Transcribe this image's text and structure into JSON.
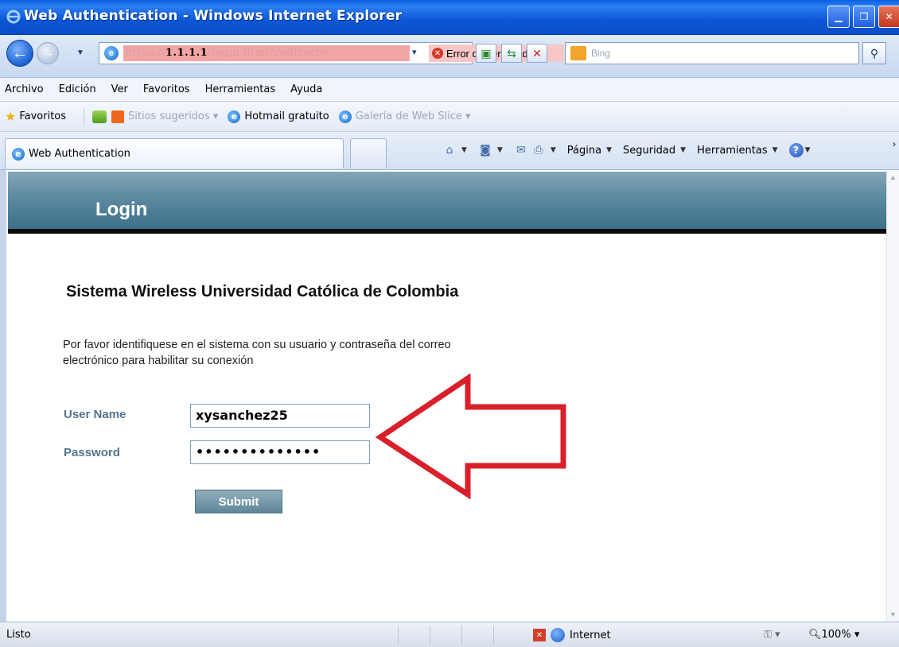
{
  "window": {
    "title": "Web Authentication - Windows Internet Explorer"
  },
  "addressbar": {
    "url_prefix": "https://",
    "url_host": "1.1.1.1",
    "url_path": "/login.html?redirect=",
    "cert_error": "Error de certificado",
    "search_placeholder": "Bing"
  },
  "menu": [
    "Archivo",
    "Edición",
    "Ver",
    "Favoritos",
    "Herramientas",
    "Ayuda"
  ],
  "favorites": {
    "label": "Favoritos",
    "items": [
      {
        "label": "Sitios sugeridos ▾",
        "dim": true
      },
      {
        "label": "Hotmail gratuito",
        "dim": false
      },
      {
        "label": "Galería de Web Slice ▾",
        "dim": true
      }
    ]
  },
  "tab": {
    "label": "Web Authentication"
  },
  "commandbar": {
    "page": "Página",
    "security": "Seguridad",
    "tools": "Herramientas"
  },
  "page": {
    "header_title": "Login",
    "heading": "Sistema Wireless Universidad Católica de Colombia",
    "description": "Por favor identifiquese en el sistema con su usuario y contraseña del correo electrónico para habilitar su conexión",
    "username_label": "User Name",
    "username_value": "xysanchez25",
    "password_label": "Password",
    "password_value": "••••••••••••••",
    "submit_label": "Submit"
  },
  "statusbar": {
    "status": "Listo",
    "zone": "Internet",
    "zoom": "100%"
  },
  "colors": {
    "titlebar": "#0a5fe0",
    "header": "#5c8aa1",
    "label": "#53758f",
    "annotation_arrow": "#d9202a"
  }
}
